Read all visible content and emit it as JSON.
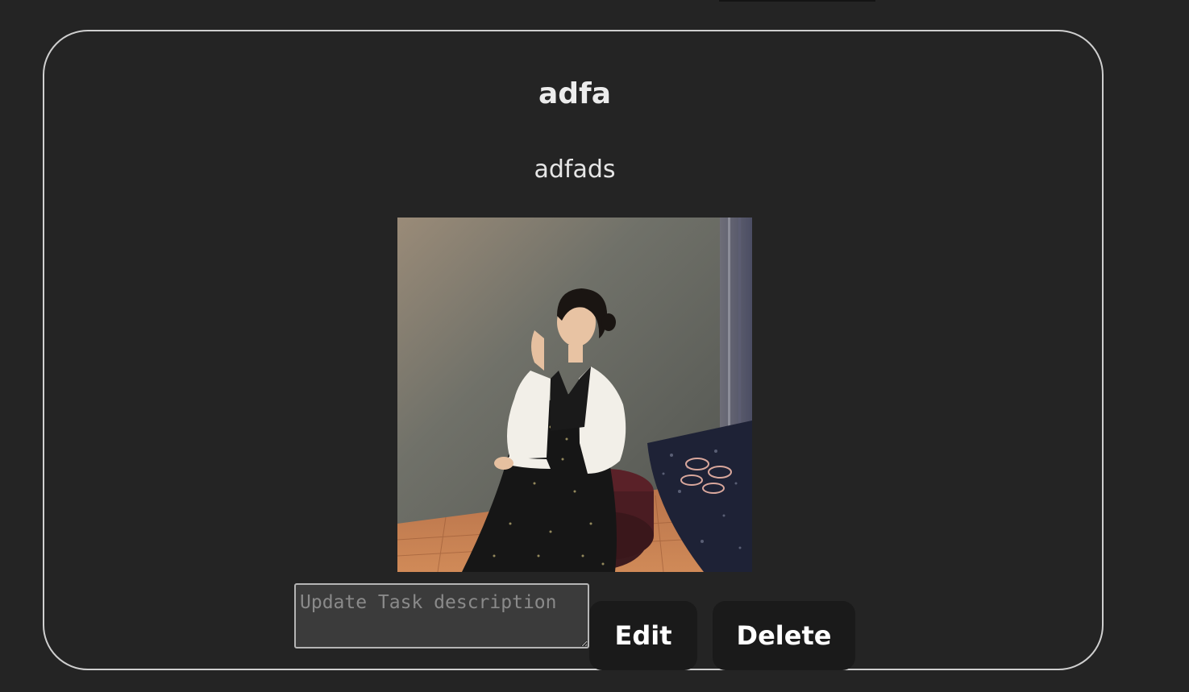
{
  "task": {
    "title": "adfa",
    "description": "adfads",
    "update_placeholder": "Update Task description"
  },
  "buttons": {
    "edit_label": "Edit",
    "delete_label": "Delete"
  },
  "colors": {
    "background": "#242424",
    "card_border": "#cfcfcf",
    "button_bg": "#1a1a1a",
    "field_bg": "#3b3b3b"
  }
}
